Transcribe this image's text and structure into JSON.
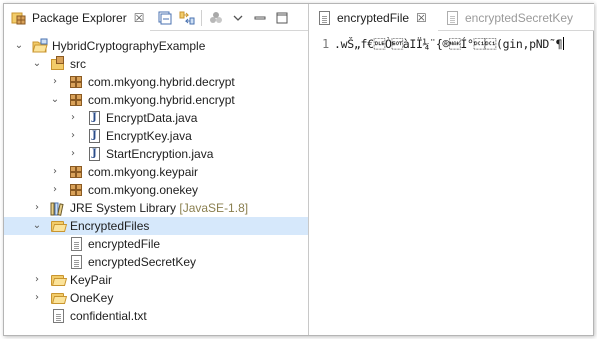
{
  "package_explorer": {
    "tab_label": "Package Explorer",
    "close_glyph": "☒"
  },
  "tree": [
    {
      "label": "HybridCryptographyExample",
      "icon": "project-icon",
      "expanded": true
    },
    {
      "label": "src",
      "icon": "source-folder-icon",
      "expanded": true
    },
    {
      "label": "com.mkyong.hybrid.decrypt",
      "icon": "package-icon",
      "expanded": false
    },
    {
      "label": "com.mkyong.hybrid.encrypt",
      "icon": "package-icon",
      "expanded": true
    },
    {
      "label": "EncryptData.java",
      "icon": "java-file-icon",
      "expanded": false
    },
    {
      "label": "EncryptKey.java",
      "icon": "java-file-icon",
      "expanded": false
    },
    {
      "label": "StartEncryption.java",
      "icon": "java-file-icon",
      "expanded": false
    },
    {
      "label": "com.mkyong.keypair",
      "icon": "package-icon",
      "expanded": false
    },
    {
      "label": "com.mkyong.onekey",
      "icon": "package-icon",
      "expanded": false
    },
    {
      "label": "JRE System Library",
      "decoration": "[JavaSE-1.8]",
      "icon": "library-icon",
      "expanded": false
    },
    {
      "label": "EncryptedFiles",
      "icon": "folder-open-icon",
      "expanded": true,
      "selected": true
    },
    {
      "label": "encryptedFile",
      "icon": "file-icon"
    },
    {
      "label": "encryptedSecretKey",
      "icon": "file-icon"
    },
    {
      "label": "KeyPair",
      "icon": "folder-icon",
      "expanded": false
    },
    {
      "label": "OneKey",
      "icon": "folder-icon",
      "expanded": false
    },
    {
      "label": "confidential.txt",
      "icon": "text-file-icon"
    }
  ],
  "editor": {
    "tabs": [
      {
        "label": "encryptedFile",
        "active": true
      },
      {
        "label": "encryptedSecretKey",
        "active": false
      }
    ],
    "close_glyph": "☒",
    "line_number": "1",
    "content": ".wŠ„f€\u0010Ò\u0004àIÏ¼¨{®\u0015Í°\u0011\u0011(gin‚pND˜¶"
  }
}
